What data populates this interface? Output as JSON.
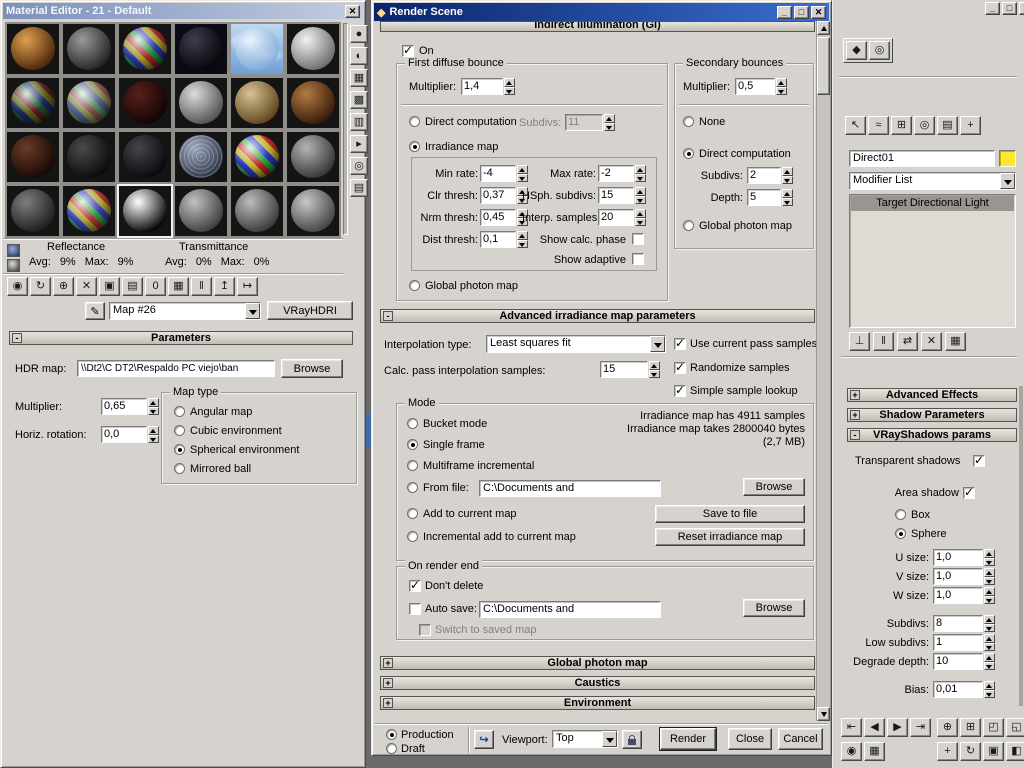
{
  "glyphs": {
    "plus": "+",
    "minus": "-",
    "close": "✕",
    "min": "_",
    "max": "□"
  },
  "me": {
    "title": "Material Editor - 21 - Default",
    "map_name": "Map #26",
    "type_button": "VRayHDRI",
    "stats": {
      "reflectance": "Reflectance",
      "transmittance": "Transmittance",
      "avg_label": "Avg:",
      "max_label": "Max:",
      "refl_avg": "9%",
      "refl_max": "9%",
      "trans_avg": "0%",
      "trans_max": "0%"
    },
    "params": {
      "header": "Parameters",
      "hdr_label": "HDR map:",
      "hdr_value": "\\\\Dt2\\C DT2\\Respaldo PC viejo\\ban",
      "browse": "Browse",
      "mult_label": "Multiplier:",
      "mult": "0,65",
      "horiz_label": "Horiz. rotation:",
      "horiz": "0,0",
      "map_type": "Map type",
      "angular": "Angular map",
      "cubic": "Cubic environment",
      "spherical": "Spherical environment",
      "mirrored": "Mirrored ball"
    },
    "slots": [
      {
        "kind": "plain",
        "hi": "#e0a050",
        "lo": "#4a2408"
      },
      {
        "kind": "plain",
        "hi": "#9a9a9a",
        "lo": "#222222"
      },
      {
        "kind": "checker",
        "c": [
          "#c03030",
          "#30a040",
          "#3040c0",
          "#c0b030"
        ]
      },
      {
        "kind": "stars"
      },
      {
        "kind": "sky"
      },
      {
        "kind": "plain",
        "hi": "#f2f2f2",
        "lo": "#6a6a6a"
      },
      {
        "kind": "checker",
        "c": [
          "#702020",
          "#206030",
          "#203070",
          "#707020"
        ]
      },
      {
        "kind": "checker",
        "c": [
          "#a06060",
          "#60a070",
          "#6070a0",
          "#a0a060"
        ]
      },
      {
        "kind": "plain",
        "hi": "#58201a",
        "lo": "#120302"
      },
      {
        "kind": "plain",
        "hi": "#dcdcdc",
        "lo": "#505050"
      },
      {
        "kind": "plain",
        "hi": "#d8c294",
        "lo": "#5e441c"
      },
      {
        "kind": "plain",
        "hi": "#b27c42",
        "lo": "#36180a"
      },
      {
        "kind": "plain",
        "hi": "#6a3a28",
        "lo": "#150803"
      },
      {
        "kind": "plain",
        "hi": "#4a4a4a",
        "lo": "#0a0a0a"
      },
      {
        "kind": "plain",
        "hi": "#44444c",
        "lo": "#08080c"
      },
      {
        "kind": "speckle",
        "hi": "#9ca8c0",
        "lo": "#2c3444"
      },
      {
        "kind": "checker",
        "c": [
          "#e03030",
          "#30c040",
          "#3040e0",
          "#e0d030"
        ]
      },
      {
        "kind": "plain",
        "hi": "#b4b4b4",
        "lo": "#343434"
      },
      {
        "kind": "plain",
        "hi": "#7e7e7e",
        "lo": "#1c1c1c"
      },
      {
        "kind": "checker",
        "c": [
          "#d04040",
          "#40b050",
          "#4050d0",
          "#d0c040"
        ]
      },
      {
        "kind": "plain",
        "hi": "#ffffff",
        "lo": "#000000",
        "active": true
      },
      {
        "kind": "plain",
        "hi": "#c2c2c2",
        "lo": "#3c3c3c"
      },
      {
        "kind": "plain",
        "hi": "#bcbcbc",
        "lo": "#383838"
      },
      {
        "kind": "plain",
        "hi": "#c8c8c8",
        "lo": "#424242"
      }
    ]
  },
  "rs": {
    "title": "Render Scene",
    "gi_header": "Indirect illumination (GI)",
    "on": "On",
    "fdb": {
      "legend": "First diffuse bounce",
      "mult_label": "Multiplier:",
      "mult": "1,4",
      "direct": "Direct computation",
      "subdivs_label": "Subdivs:",
      "subdivs": "11",
      "irr": "Irradiance map",
      "min_rate_l": "Min rate:",
      "min_rate": "-4",
      "max_rate_l": "Max rate:",
      "max_rate": "-2",
      "clr_l": "Clr thresh:",
      "clr": "0,37",
      "hsph_l": "HSph. subdivs:",
      "hsph": "15",
      "nrm_l": "Nrm thresh:",
      "nrm": "0,45",
      "interp_l": "Interp. samples:",
      "interp": "20",
      "dist_l": "Dist thresh:",
      "dist": "0,1",
      "show_calc": "Show calc. phase",
      "show_adapt": "Show adaptive",
      "gpm": "Global photon map"
    },
    "sb": {
      "legend": "Secondary bounces",
      "mult_label": "Multiplier:",
      "mult": "0,5",
      "none": "None",
      "direct": "Direct computation",
      "subdivs_label": "Subdivs:",
      "subdivs": "2",
      "depth_label": "Depth:",
      "depth": "5",
      "gpm": "Global photon map"
    },
    "adv": {
      "header": "Advanced irradiance map parameters",
      "interp_label": "Interpolation type:",
      "interp": "Least squares fit",
      "calc_label": "Calc. pass interpolation samples:",
      "calc": "15",
      "use_current": "Use current pass samples",
      "randomize": "Randomize samples",
      "simple": "Simple sample lookup"
    },
    "mode": {
      "legend": "Mode",
      "bucket": "Bucket mode",
      "single": "Single frame",
      "multi": "Multiframe incremental",
      "from_file": "From file:",
      "file": "C:\\Documents and",
      "add": "Add to current map",
      "incr": "Incremental add to current map",
      "info1": "Irradiance map has 4911 samples",
      "info2": "Irradiance map takes 2800040 bytes",
      "info3": "(2,7 MB)",
      "browse": "Browse",
      "save": "Save to file",
      "reset": "Reset irradiance map"
    },
    "ore": {
      "legend": "On render end",
      "dont": "Don't delete",
      "autosave": "Auto save:",
      "file": "C:\\Documents and",
      "browse": "Browse",
      "switch_map": "Switch to saved map"
    },
    "rollouts": [
      "Global photon map",
      "Caustics",
      "Environment"
    ],
    "bottom": {
      "production": "Production",
      "draft": "Draft",
      "viewport_label": "Viewport:",
      "viewport": "Top",
      "render": "Render",
      "close": "Close",
      "cancel": "Cancel"
    }
  },
  "cp": {
    "name": "Direct01",
    "modifier_list": "Modifier List",
    "stack_item": "Target Directional Light",
    "rollout_adv": "Advanced Effects",
    "rollout_shadow": "Shadow Parameters",
    "rollout_vray": "VRayShadows params",
    "transparent": "Transparent shadows",
    "area": "Area shadow",
    "box": "Box",
    "sphere": "Sphere",
    "u_label": "U size:",
    "v_label": "V size:",
    "w_label": "W size:",
    "u": "1,0",
    "v": "1,0",
    "w": "1,0",
    "subdivs_label": "Subdivs:",
    "subdivs": "8",
    "low_label": "Low subdivs:",
    "low": "1",
    "degrade_label": "Degrade depth:",
    "degrade": "10",
    "bias_label": "Bias:",
    "bias": "0,01",
    "swatch_color": "#ffe72e"
  },
  "state": {
    "gi_on": true,
    "irr": true,
    "sb_direct": true,
    "single": true,
    "use_current": true,
    "randomize": true,
    "simple": true,
    "dont": true,
    "production": true,
    "spherical": true,
    "transparent": true,
    "area": true,
    "sphere": true
  },
  "icons": {
    "eyedropper": "✎",
    "preset_arrow": "↪",
    "rs_win": [
      "_",
      "□",
      "✕"
    ],
    "main_win": [
      "_",
      "□",
      "✕"
    ],
    "me_side": [
      {
        "name": "sample-type-icon",
        "glyph": "●"
      },
      {
        "name": "backlight-icon",
        "glyph": "◐"
      },
      {
        "name": "background-icon",
        "glyph": "▦"
      },
      {
        "name": "uv-tiling-icon",
        "glyph": "▩"
      },
      {
        "name": "video-color-check-icon",
        "glyph": "▥"
      },
      {
        "name": "make-preview-icon",
        "glyph": "▸"
      },
      {
        "name": "select-by-material-icon",
        "glyph": "◎"
      },
      {
        "name": "map-navigator-icon",
        "glyph": "▤"
      }
    ],
    "me_toolbar": [
      {
        "name": "get-material-icon",
        "glyph": "◉"
      },
      {
        "name": "put-to-scene-icon",
        "glyph": "↻"
      },
      {
        "name": "assign-to-selection-icon",
        "glyph": "⊕"
      },
      {
        "name": "reset-map-icon",
        "glyph": "✕"
      },
      {
        "name": "make-copy-icon",
        "glyph": "▣"
      },
      {
        "name": "put-to-library-icon",
        "glyph": "▤"
      },
      {
        "name": "material-id-icon",
        "glyph": "0"
      },
      {
        "name": "show-map-in-viewport-icon",
        "glyph": "▦"
      },
      {
        "name": "show-end-result-icon",
        "glyph": "‖"
      },
      {
        "name": "go-to-parent-icon",
        "glyph": "↥"
      },
      {
        "name": "go-forward-icon",
        "glyph": "↦"
      }
    ],
    "render_shortcuts": [
      {
        "name": "render-scene-dialog-icon",
        "glyph": "◆"
      },
      {
        "name": "render-last-icon",
        "glyph": "◎"
      }
    ],
    "cp_tabs": [
      {
        "name": "panel-create-icon",
        "glyph": "↖"
      },
      {
        "name": "panel-modify-icon",
        "glyph": "≈"
      },
      {
        "name": "panel-hierarchy-icon",
        "glyph": "⊞"
      },
      {
        "name": "panel-motion-icon",
        "glyph": "◎"
      },
      {
        "name": "panel-display-icon",
        "glyph": "▤"
      },
      {
        "name": "panel-utilities-icon",
        "glyph": "+"
      }
    ],
    "cp_stack_tools": [
      {
        "name": "pin-stack-icon",
        "glyph": "⊥"
      },
      {
        "name": "show-end-result-icon",
        "glyph": "‖"
      },
      {
        "name": "make-unique-icon",
        "glyph": "⇄"
      },
      {
        "name": "remove-modifier-icon",
        "glyph": "✕"
      },
      {
        "name": "configure-modifier-sets-icon",
        "glyph": "▦"
      }
    ],
    "time_row1": [
      {
        "name": "go-to-start-icon",
        "glyph": "⇤"
      },
      {
        "name": "previous-frame-icon",
        "glyph": "◀"
      },
      {
        "name": "play-icon",
        "glyph": "▶"
      },
      {
        "name": "go-to-end-icon",
        "glyph": "⇥"
      }
    ],
    "time_row2": [
      {
        "name": "key-mode-icon",
        "glyph": "◉"
      },
      {
        "name": "time-config-icon",
        "glyph": "▦"
      }
    ],
    "nav_row1": [
      {
        "name": "zoom-icon",
        "glyph": "⊕"
      },
      {
        "name": "zoom-all-icon",
        "glyph": "⊞"
      },
      {
        "name": "zoom-extents-icon",
        "glyph": "◰"
      },
      {
        "name": "zoom-extents-all-icon",
        "glyph": "◱"
      }
    ],
    "nav_row2": [
      {
        "name": "pan-icon",
        "glyph": "+"
      },
      {
        "name": "arc-rotate-icon",
        "glyph": "↻"
      },
      {
        "name": "region-zoom-icon",
        "glyph": "▣"
      },
      {
        "name": "maximize-viewport-icon",
        "glyph": "◧"
      }
    ]
  }
}
